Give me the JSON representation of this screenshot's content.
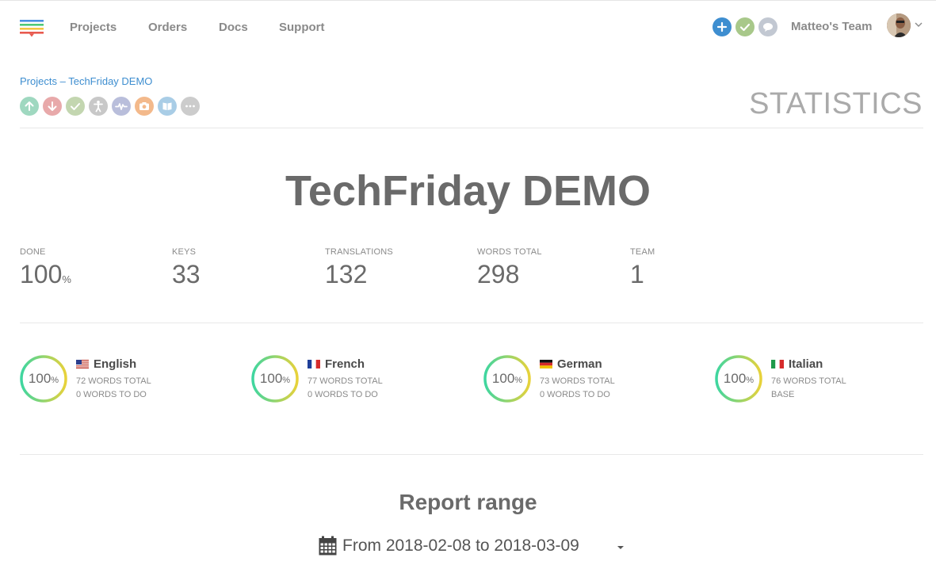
{
  "nav": {
    "links": [
      "Projects",
      "Orders",
      "Docs",
      "Support"
    ],
    "team_name": "Matteo's Team"
  },
  "breadcrumb": {
    "root": "Projects",
    "separator": "–",
    "current": "TechFriday DEMO"
  },
  "page_section_title": "STATISTICS",
  "project_title": "TechFriday DEMO",
  "stats": [
    {
      "label": "DONE",
      "value": "100",
      "unit": "%"
    },
    {
      "label": "KEYS",
      "value": "33",
      "unit": ""
    },
    {
      "label": "TRANSLATIONS",
      "value": "132",
      "unit": ""
    },
    {
      "label": "WORDS TOTAL",
      "value": "298",
      "unit": ""
    },
    {
      "label": "TEAM",
      "value": "1",
      "unit": ""
    }
  ],
  "languages": [
    {
      "name": "English",
      "flag": "us-flag",
      "percent": "100",
      "unit": "%",
      "progress": 1.0,
      "words_total": "72 WORDS TOTAL",
      "words_todo": "0 WORDS TO DO"
    },
    {
      "name": "French",
      "flag": "fr-flag",
      "percent": "100",
      "unit": "%",
      "progress": 1.0,
      "words_total": "77 WORDS TOTAL",
      "words_todo": "0 WORDS TO DO"
    },
    {
      "name": "German",
      "flag": "de-flag",
      "percent": "100",
      "unit": "%",
      "progress": 1.0,
      "words_total": "73 WORDS TOTAL",
      "words_todo": "0 WORDS TO DO"
    },
    {
      "name": "Italian",
      "flag": "it-flag",
      "percent": "100",
      "unit": "%",
      "progress": 1.0,
      "words_total": "76 WORDS TOTAL",
      "words_todo": "BASE"
    }
  ],
  "report": {
    "title": "Report range",
    "range_text": "From 2018-02-08 to 2018-03-09"
  },
  "colors": {
    "link_blue": "#3e8ed0",
    "add_blue": "#3e8ed0",
    "check_green": "#8cc152",
    "ring_start": "#3ed6a0",
    "ring_end": "#e8d23a"
  },
  "icons": {
    "top": [
      "plus-icon",
      "check-icon",
      "chat-bubble-icon"
    ],
    "project_tools": [
      "upload-icon",
      "download-icon",
      "check-icon",
      "accessibility-icon",
      "activity-icon",
      "camera-icon",
      "book-icon",
      "more-icon"
    ]
  }
}
